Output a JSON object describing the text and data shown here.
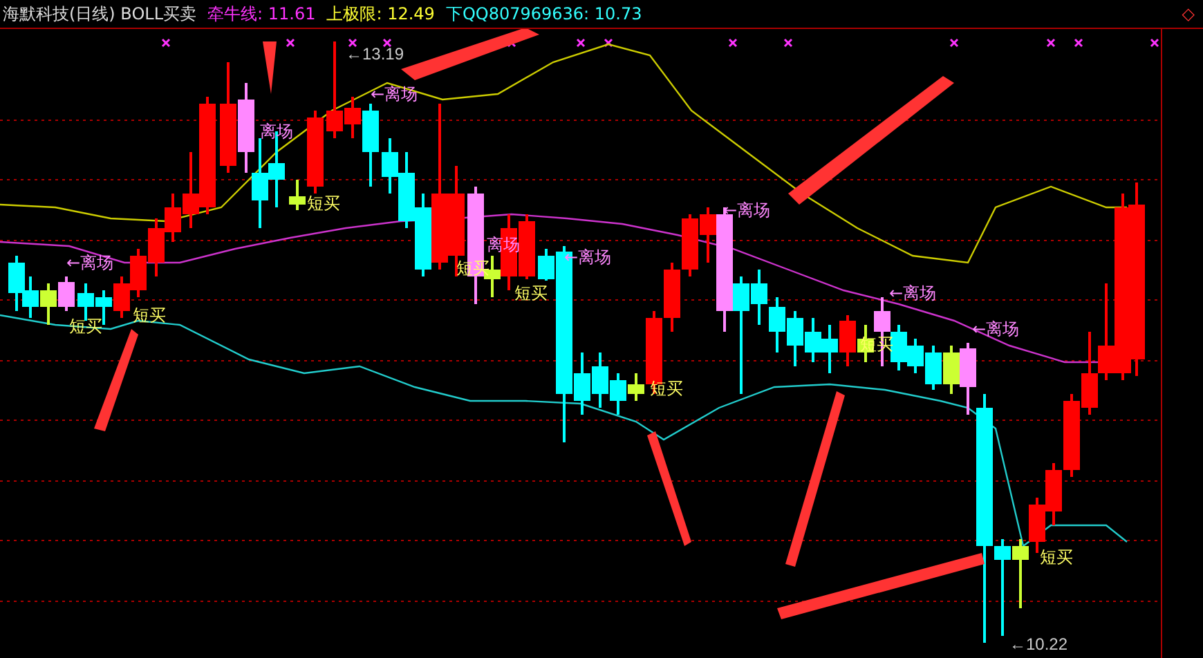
{
  "header": {
    "title": "海默科技(日线) BOLL买卖",
    "readings": [
      {
        "label": "牵牛线: 11.61",
        "color": "#ff33ff"
      },
      {
        "label": "上极限: 12.49",
        "color": "#ffff33"
      },
      {
        "label": "下QQ807969636: 10.73",
        "color": "#33ffff"
      }
    ],
    "marker": "◇"
  },
  "chart": {
    "price_labels": [
      "←13.19",
      "←10.22"
    ],
    "signals": [
      {
        "kind": "exit",
        "text": "←离场"
      },
      {
        "kind": "exit",
        "text": "离场"
      },
      {
        "kind": "exit",
        "text": "←离场"
      },
      {
        "kind": "exit",
        "text": "←离场"
      },
      {
        "kind": "exit",
        "text": "←离场"
      },
      {
        "kind": "exit",
        "text": "←离场"
      },
      {
        "kind": "exit",
        "text": "←离场"
      },
      {
        "kind": "exit",
        "text": "离场"
      },
      {
        "kind": "buy",
        "text": "短买"
      },
      {
        "kind": "buy",
        "text": "短买"
      },
      {
        "kind": "buy",
        "text": "短买"
      },
      {
        "kind": "buy",
        "text": "短买"
      },
      {
        "kind": "buy",
        "text": "短买"
      },
      {
        "kind": "buy",
        "text": "短买"
      },
      {
        "kind": "buy",
        "text": "短买"
      },
      {
        "kind": "buy",
        "text": "短买"
      }
    ]
  }
}
